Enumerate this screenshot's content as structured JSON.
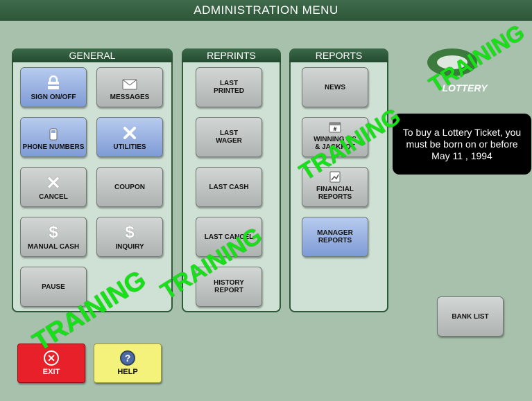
{
  "header": {
    "title": "ADMINISTRATION MENU"
  },
  "panels": {
    "general": {
      "title": "GENERAL"
    },
    "reprints": {
      "title": "REPRINTS"
    },
    "reports": {
      "title": "REPORTS"
    }
  },
  "general_buttons": {
    "sign": "SIGN ON/OFF",
    "messages": "MESSAGES",
    "phone": "PHONE NUMBERS",
    "utilities": "UTILITIES",
    "cancel": "CANCEL",
    "coupon": "COUPON",
    "manual_cash": "MANUAL CASH",
    "inquiry": "INQUIRY",
    "pause": "PAUSE"
  },
  "reprint_buttons": {
    "last_printed": "LAST PRINTED",
    "last_wager": "LAST WAGER",
    "last_cash": "LAST CASH",
    "last_cancel": "LAST CANCEL",
    "history_report": "HISTORY REPORT"
  },
  "report_buttons": {
    "news": "NEWS",
    "winning": "WINNING #'S & JACKPOT",
    "financial": "FINANCIAL REPORTS",
    "manager": "MANAGER REPORTS"
  },
  "bank_list": "BANK LIST",
  "exit": "EXIT",
  "help": "HELP",
  "logo": {
    "text": "LOTTERY"
  },
  "notice": {
    "text": "To buy a Lottery Ticket, you must be born on or before May 11 , 1994"
  },
  "watermark": {
    "text": "TRAINING"
  },
  "colors": {
    "title_bar": "#2e5638",
    "background": "#a7c1ad",
    "blue_button": "#8fa9dd",
    "exit": "#e8202a",
    "help": "#f4f27a"
  }
}
